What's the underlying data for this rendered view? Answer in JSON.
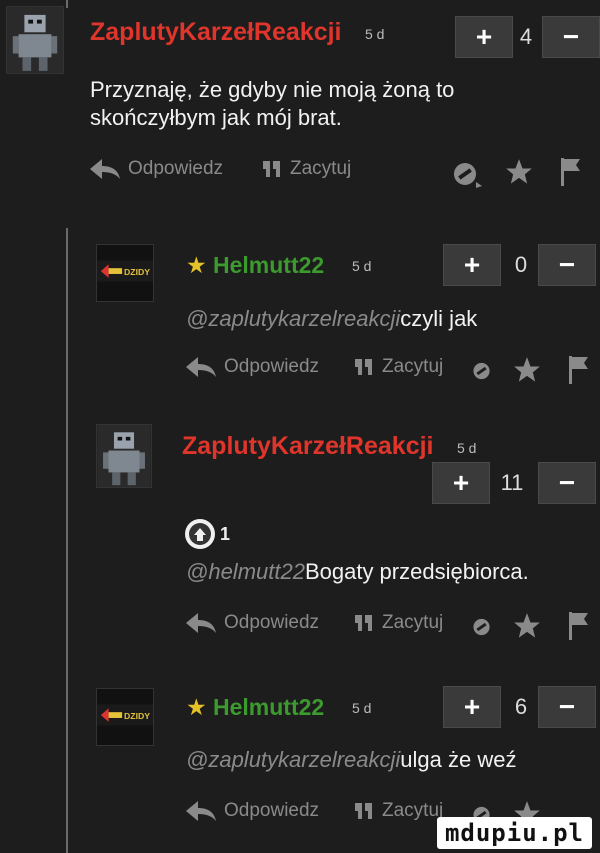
{
  "comments": [
    {
      "username": "ZaplutyKarzełReakcji",
      "age": "5 d",
      "votes": "4",
      "text_line1": "Przyznaję, że gdyby nie moją żoną to",
      "text_line2": "skończyłbym jak mój brat."
    },
    {
      "username": "Helmutt22",
      "age": "5 d",
      "votes": "0",
      "mention": "@zaplutykarzelreakcji",
      "text": "czyli jak"
    },
    {
      "username": "ZaplutyKarzełReakcji",
      "age": "5 d",
      "votes": "11",
      "badge_count": "1",
      "mention": "@helmutt22",
      "text": "Bogaty przedsiębiorca."
    },
    {
      "username": "Helmutt22",
      "age": "5 d",
      "votes": "6",
      "mention": "@zaplutykarzelreakcji",
      "text": "ulga że weź"
    }
  ],
  "actions": {
    "reply": "Odpowiedz",
    "quote": "Zacytuj"
  },
  "vote": {
    "plus": "+",
    "minus": "−"
  },
  "avatar_text": "DZIDY",
  "watermark": "mdupiu.pl",
  "colors": {
    "author": "#e0352b",
    "helmutt": "#3c9a2e",
    "star": "#e6c229",
    "background": "#1d1d1d"
  }
}
